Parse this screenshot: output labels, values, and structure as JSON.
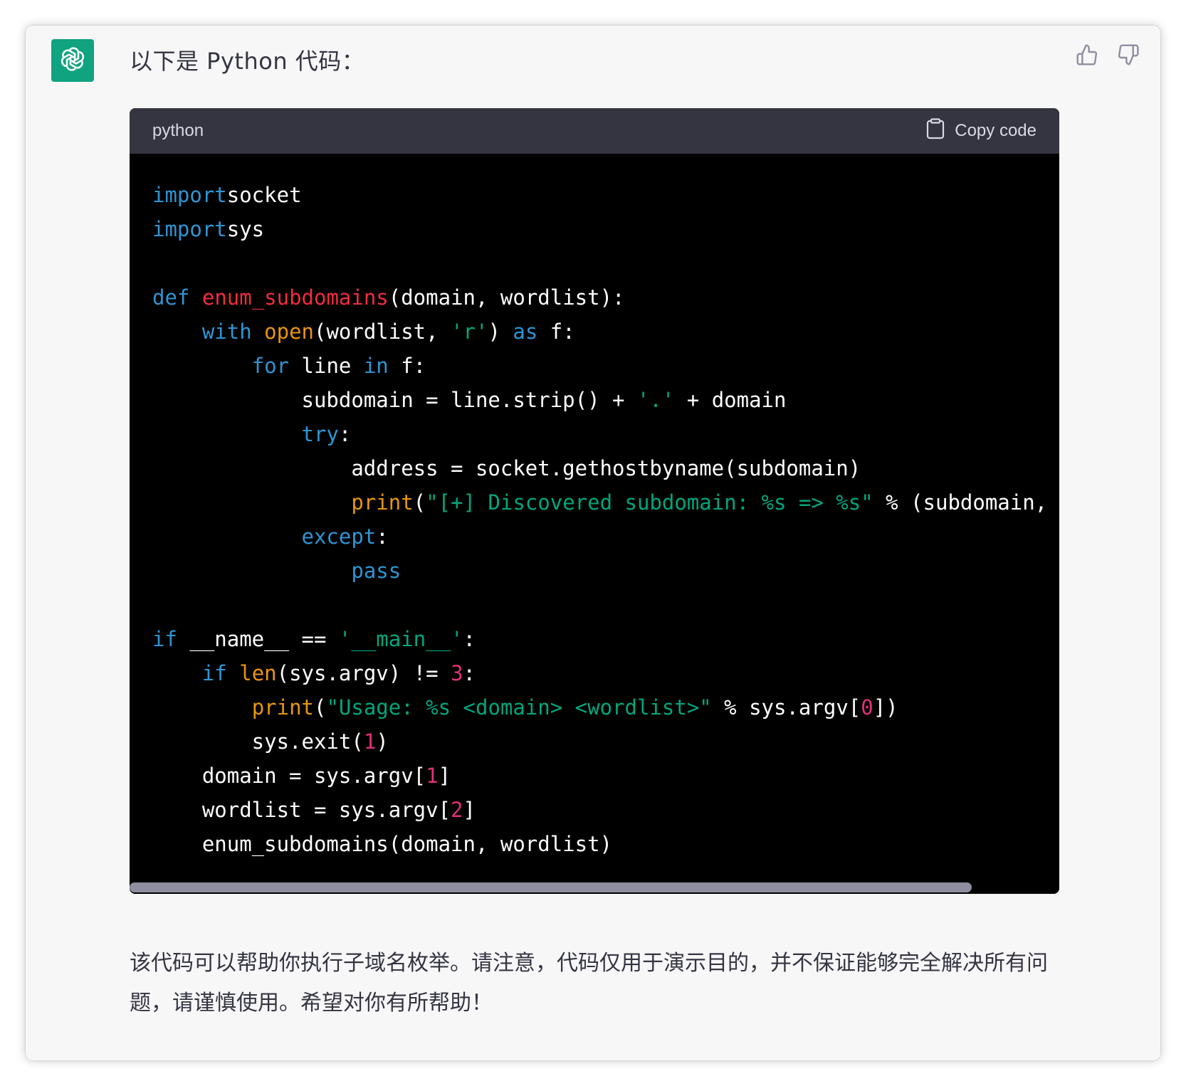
{
  "message": {
    "intro": "以下是 Python 代码：",
    "outro": "该代码可以帮助你执行子域名枚举。请注意，代码仅用于演示目的，并不保证能够完全解决所有问题，请谨慎使用。希望对你有所帮助！"
  },
  "avatar": {
    "icon": "openai-logo-icon",
    "color": "#10a37f"
  },
  "feedback": {
    "up_icon": "thumbs-up-icon",
    "down_icon": "thumbs-down-icon"
  },
  "code_block": {
    "language": "python",
    "copy_label": "Copy code",
    "copy_icon": "clipboard-icon",
    "colors": {
      "keyword": "#2e95d3",
      "function_name": "#f22c3d",
      "builtin": "#e9950c",
      "string": "#00a67d",
      "number": "#df3079"
    },
    "lines": [
      [
        [
          "kw",
          "import"
        ],
        [
          "",
          "socket"
        ]
      ],
      [
        [
          "kw",
          "import"
        ],
        [
          "",
          "sys"
        ]
      ],
      [],
      [
        [
          "kw",
          "def"
        ],
        [
          "",
          " "
        ],
        [
          "fn",
          "enum_subdomains"
        ],
        [
          "",
          "(domain, wordlist):"
        ]
      ],
      [
        [
          "",
          "    "
        ],
        [
          "kw",
          "with"
        ],
        [
          "",
          " "
        ],
        [
          "bi",
          "open"
        ],
        [
          "",
          "(wordlist, "
        ],
        [
          "st",
          "'r'"
        ],
        [
          "",
          ") "
        ],
        [
          "kw",
          "as"
        ],
        [
          "",
          "",
          " f:"
        ]
      ],
      [
        [
          "",
          "        "
        ],
        [
          "kw",
          "for"
        ],
        [
          "",
          " line "
        ],
        [
          "kw",
          "in"
        ],
        [
          "",
          " f:"
        ]
      ],
      [
        [
          "",
          "            subdomain = line.strip() + "
        ],
        [
          "st",
          "'.'"
        ],
        [
          "",
          " + domain"
        ]
      ],
      [
        [
          "",
          "            "
        ],
        [
          "kw",
          "try"
        ],
        [
          "",
          ":"
        ]
      ],
      [
        [
          "",
          "                address = socket.gethostbyname(subdomain)"
        ]
      ],
      [
        [
          "",
          "                "
        ],
        [
          "bi",
          "print"
        ],
        [
          "",
          "("
        ],
        [
          "st",
          "\"[+] Discovered subdomain: %s => %s\""
        ],
        [
          "",
          " % (subdomain, address))"
        ]
      ],
      [
        [
          "",
          "            "
        ],
        [
          "kw",
          "except"
        ],
        [
          "",
          ":"
        ]
      ],
      [
        [
          "",
          "                "
        ],
        [
          "kw",
          "pass"
        ]
      ],
      [],
      [
        [
          "kw",
          "if"
        ],
        [
          "",
          " __name__ == "
        ],
        [
          "st",
          "'__main__'"
        ],
        [
          "",
          ":"
        ]
      ],
      [
        [
          "",
          "    "
        ],
        [
          "kw",
          "if"
        ],
        [
          "",
          " "
        ],
        [
          "bi",
          "len"
        ],
        [
          "",
          "(sys.argv) != "
        ],
        [
          "nu",
          "3"
        ],
        [
          "",
          ":"
        ]
      ],
      [
        [
          "",
          "        "
        ],
        [
          "bi",
          "print"
        ],
        [
          "",
          "("
        ],
        [
          "st",
          "\"Usage: %s <domain> <wordlist>\""
        ],
        [
          "",
          " % sys.argv["
        ],
        [
          "nu",
          "0"
        ],
        [
          "",
          "])"
        ]
      ],
      [
        [
          "",
          "        sys.exit("
        ],
        [
          "nu",
          "1"
        ],
        [
          "",
          ")"
        ]
      ],
      [
        [
          "",
          "    domain = sys.argv["
        ],
        [
          "nu",
          "1"
        ],
        [
          "",
          "]"
        ]
      ],
      [
        [
          "",
          "    wordlist = sys.argv["
        ],
        [
          "nu",
          "2"
        ],
        [
          "",
          "]"
        ]
      ],
      [
        [
          "",
          "    enum_subdomains(domain, wordlist)"
        ]
      ]
    ]
  },
  "scrollbar": {
    "position": 0,
    "visible_fraction": 0.91
  }
}
